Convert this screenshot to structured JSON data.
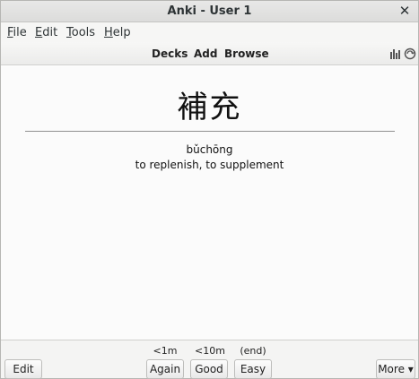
{
  "window": {
    "title": "Anki - User 1",
    "close_glyph": "✕"
  },
  "menubar": {
    "items": [
      {
        "underline": "F",
        "rest": "ile"
      },
      {
        "underline": "E",
        "rest": "dit"
      },
      {
        "underline": "T",
        "rest": "ools"
      },
      {
        "underline": "H",
        "rest": "elp"
      }
    ]
  },
  "toolbar": {
    "decks": "Decks",
    "add": "Add",
    "browse": "Browse",
    "icons": [
      "stats-icon",
      "sync-icon"
    ]
  },
  "card": {
    "front": "補充",
    "pinyin": "bǔchōng",
    "meaning": "to replenish, to supplement"
  },
  "answer_bar": {
    "intervals": {
      "again": "<1m",
      "good": "<10m",
      "easy": "(end)"
    },
    "buttons": {
      "edit": "Edit",
      "again": "Again",
      "good": "Good",
      "easy": "Easy",
      "more": "More ▾"
    }
  }
}
